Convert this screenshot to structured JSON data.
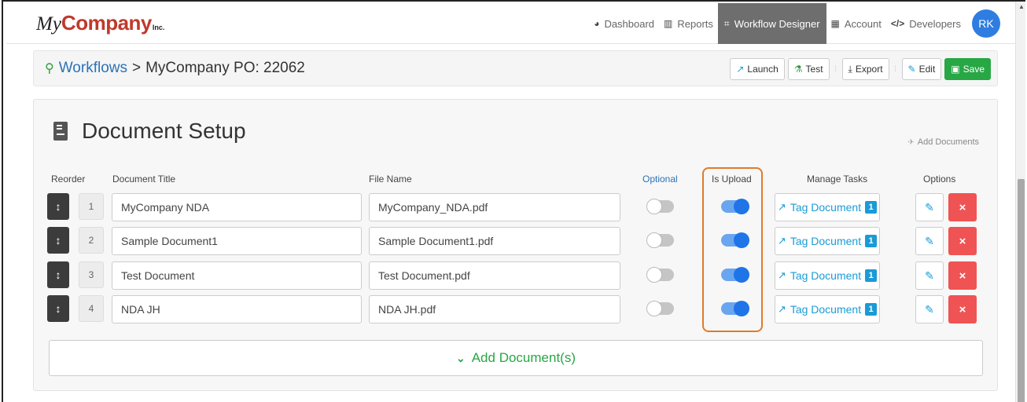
{
  "brand": {
    "logo_my": "My",
    "logo_company": "Company",
    "logo_inc": "Inc."
  },
  "nav": {
    "items": [
      {
        "icon": "dashboard-icon",
        "label": "Dashboard"
      },
      {
        "icon": "reports-icon",
        "label": "Reports"
      },
      {
        "icon": "workflow-designer-icon",
        "label": "Workflow Designer",
        "active": true
      },
      {
        "icon": "account-icon",
        "label": "Account"
      },
      {
        "icon": "developers-icon",
        "label": "Developers"
      }
    ],
    "avatar": "RK"
  },
  "breadcrumb": {
    "root": "Workflows",
    "separator": ">",
    "current": "MyCompany PO: 22062"
  },
  "toolbar": {
    "launch": "Launch",
    "test": "Test",
    "export": "Export",
    "edit": "Edit",
    "save": "Save"
  },
  "section": {
    "title": "Document Setup",
    "add_documents_link": "Add Documents"
  },
  "table": {
    "headers": {
      "reorder": "Reorder",
      "title": "Document Title",
      "file": "File Name",
      "optional": "Optional",
      "upload": "Is Upload",
      "tasks": "Manage Tasks",
      "options": "Options"
    },
    "rows": [
      {
        "num": "1",
        "title": "MyCompany NDA",
        "file": "MyCompany_NDA.pdf",
        "optional": false,
        "is_upload": true,
        "tag_label": "Tag Document",
        "tag_count": "1"
      },
      {
        "num": "2",
        "title": "Sample Document1",
        "file": "Sample Document1.pdf",
        "optional": false,
        "is_upload": true,
        "tag_label": "Tag Document",
        "tag_count": "1"
      },
      {
        "num": "3",
        "title": "Test Document",
        "file": "Test Document.pdf",
        "optional": false,
        "is_upload": true,
        "tag_label": "Tag Document",
        "tag_count": "1"
      },
      {
        "num": "4",
        "title": "NDA JH",
        "file": "NDA JH.pdf",
        "optional": false,
        "is_upload": true,
        "tag_label": "Tag Document",
        "tag_count": "1"
      }
    ]
  },
  "add_document_button": "Add Document(s)",
  "colors": {
    "accent_blue": "#1a9bd7",
    "save_green": "#28a745",
    "delete_red": "#f05353",
    "highlight_orange": "#e07b2a",
    "avatar_blue": "#2f7de1"
  }
}
